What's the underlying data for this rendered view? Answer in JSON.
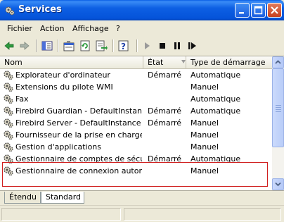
{
  "window": {
    "title": "Services"
  },
  "menu": [
    "Fichier",
    "Action",
    "Affichage",
    "?"
  ],
  "columns": {
    "name": "Nom",
    "state": "État",
    "startup": "Type de démarrage"
  },
  "services": [
    {
      "name": "Explorateur d'ordinateur",
      "state": "Démarré",
      "startup": "Automatique"
    },
    {
      "name": "Extensions du pilote WMI",
      "state": "",
      "startup": "Manuel"
    },
    {
      "name": "Fax",
      "state": "",
      "startup": "Automatique"
    },
    {
      "name": "Firebird Guardian - DefaultInstance",
      "state": "Démarré",
      "startup": "Automatique"
    },
    {
      "name": "Firebird Server - DefaultInstance",
      "state": "Démarré",
      "startup": "Manuel"
    },
    {
      "name": "Fournisseur de la prise en charge ...",
      "state": "",
      "startup": "Manuel"
    },
    {
      "name": "Gestion d'applications",
      "state": "",
      "startup": "Manuel"
    },
    {
      "name": "Gestionnaire de comptes de sécurité",
      "state": "Démarré",
      "startup": "Automatique"
    },
    {
      "name": "Gestionnaire de connexion autom...",
      "state": "",
      "startup": "Manuel"
    }
  ],
  "tabs": [
    "Étendu",
    "Standard"
  ],
  "colors": {
    "titlebar": "#0453d9",
    "highlight_box": "#d02020",
    "face": "#ece9d8"
  },
  "icons": {
    "title": "gear-icon",
    "toolbar": [
      "back-arrow-icon",
      "forward-arrow-icon",
      "console-tree-icon",
      "properties-icon",
      "refresh-icon",
      "export-list-icon",
      "help-icon",
      "play-icon",
      "stop-icon",
      "pause-icon",
      "restart-icon"
    ]
  }
}
